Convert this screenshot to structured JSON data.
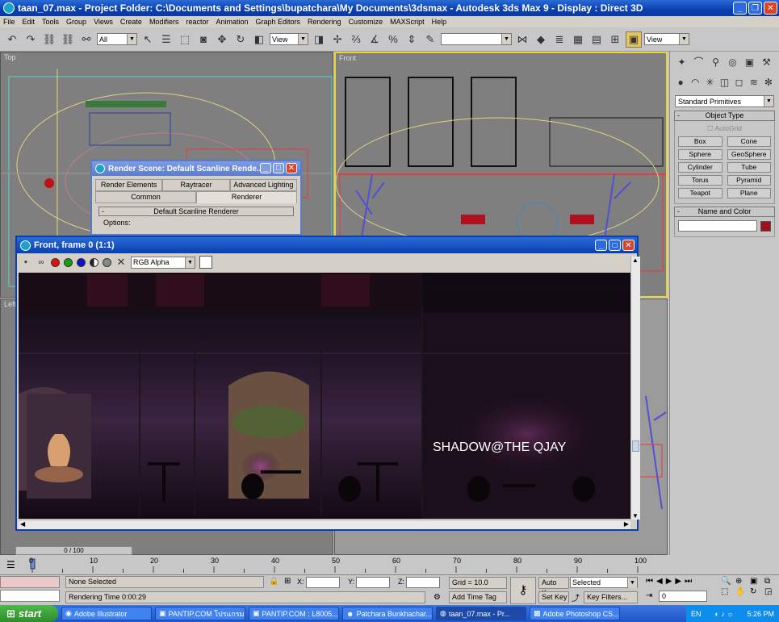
{
  "window": {
    "title": "taan_07.max    - Project Folder: C:\\Documents and Settings\\bupatchara\\My Documents\\3dsmax    - Autodesk 3ds Max 9      - Display : Direct 3D"
  },
  "menu": [
    "File",
    "Edit",
    "Tools",
    "Group",
    "Views",
    "Create",
    "Modifiers",
    "reactor",
    "Animation",
    "Graph Editors",
    "Rendering",
    "Customize",
    "MAXScript",
    "Help"
  ],
  "toolbar": {
    "selection_filter": "All",
    "ref_coord": "View",
    "view_dropdown_right": "View"
  },
  "viewports": {
    "top": "Top",
    "front": "Front",
    "left": "Left"
  },
  "command_panel": {
    "category": "Standard Primitives",
    "object_type_title": "Object Type",
    "autogrid": "AutoGrid",
    "primitives": [
      "Box",
      "Cone",
      "Sphere",
      "GeoSphere",
      "Cylinder",
      "Tube",
      "Torus",
      "Pyramid",
      "Teapot",
      "Plane"
    ],
    "name_color_title": "Name and Color",
    "object_color": "#a0101c"
  },
  "render_scene": {
    "title": "Render Scene: Default Scanline Rende...",
    "tabs_row1": [
      "Render Elements",
      "Raytracer",
      "Advanced Lighting"
    ],
    "tabs_row2": [
      "Common",
      "Renderer"
    ],
    "renderer_rollout": "Default Scanline Renderer",
    "options_label": "Options:"
  },
  "render_frame": {
    "title": "Front, frame 0 (1:1)",
    "channel": "RGB Alpha",
    "overlay_text": "SHADOW@THE QJAY"
  },
  "timeline": {
    "slider": "0 / 100",
    "ticks": [
      "0",
      "10",
      "20",
      "30",
      "40",
      "50",
      "60",
      "70",
      "80",
      "90",
      "100"
    ]
  },
  "status": {
    "selection": "None Selected",
    "render_time": "Rendering Time  0:00:29",
    "x_label": "X:",
    "y_label": "Y:",
    "z_label": "Z:",
    "grid": "Grid = 10.0",
    "add_time_tag": "Add Time Tag",
    "auto_key": "Auto Key",
    "set_key": "Set Key",
    "key_mode": "Selected",
    "key_filters": "Key Filters...",
    "frame": "0"
  },
  "taskbar": {
    "start": "start",
    "tasks": [
      "Adobe Illustrator",
      "PANTIP.COM โปรแกรม...",
      "PANTIP.COM : L8005...",
      "Patchara Bunkhachar...",
      "taan_07.max - Pr...",
      "Adobe Photoshop CS..."
    ],
    "lang": "EN",
    "clock": "5:26 PM"
  }
}
